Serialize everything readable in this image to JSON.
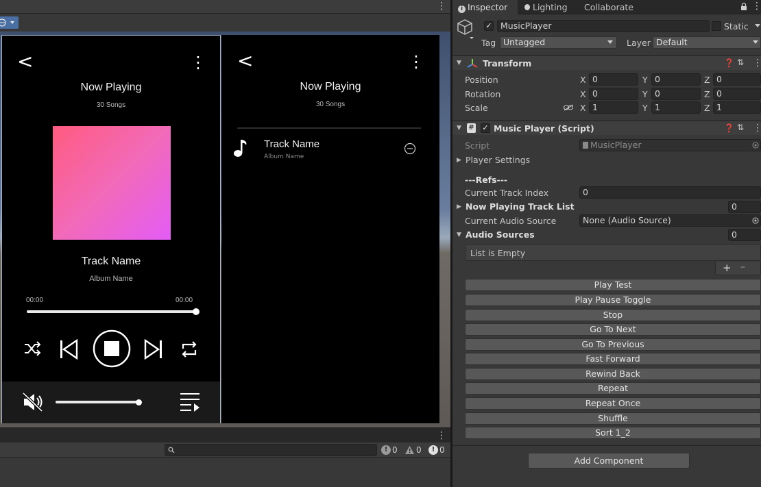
{
  "game_view": {
    "menu_glyph": "⋮",
    "phone_now_playing": {
      "back": "<",
      "menu": "⋮",
      "title": "Now Playing",
      "subtitle": "30 Songs",
      "track_name": "Track Name",
      "album_name": "Album Name",
      "time_current": "00:00",
      "time_total": "00:00",
      "progress": 1.0,
      "volume": 0.95
    },
    "phone_playlist": {
      "back": "<",
      "menu": "⋮",
      "title": "Now Playing",
      "subtitle": "30 Songs",
      "rows": [
        {
          "track": "Track Name",
          "album": "Album Name"
        }
      ]
    }
  },
  "console": {
    "menu_glyph": "⋮",
    "search_placeholder": "",
    "info_count": "0",
    "warning_count": "0",
    "error_count": "0"
  },
  "inspector": {
    "tabs": [
      {
        "label": "Inspector",
        "icon": "info-icon"
      },
      {
        "label": "Lighting",
        "icon": "bulb-icon"
      },
      {
        "label": "Collaborate",
        "icon": ""
      }
    ],
    "object": {
      "name": "MusicPlayer",
      "active": true,
      "static_label": "Static",
      "tag_label": "Tag",
      "tag_value": "Untagged",
      "layer_label": "Layer",
      "layer_value": "Default"
    },
    "transform": {
      "title": "Transform",
      "position": {
        "label": "Position",
        "x": "0",
        "y": "0",
        "z": "0"
      },
      "rotation": {
        "label": "Rotation",
        "x": "0",
        "y": "0",
        "z": "0"
      },
      "scale": {
        "label": "Scale",
        "x": "1",
        "y": "1",
        "z": "1"
      },
      "axis_x": "X",
      "axis_y": "Y",
      "axis_z": "Z"
    },
    "music_player": {
      "title": "Music Player (Script)",
      "script_label": "Script",
      "script_value": "MusicPlayer",
      "player_settings": "Player Settings",
      "refs_header": "---Refs---",
      "current_track_index_label": "Current Track Index",
      "current_track_index_value": "0",
      "now_playing_list_label": "Now Playing Track List",
      "now_playing_list_count": "0",
      "current_audio_source_label": "Current Audio Source",
      "current_audio_source_value": "None (Audio Source)",
      "audio_sources_label": "Audio Sources",
      "audio_sources_count": "0",
      "list_empty": "List is Empty",
      "add_glyph": "+",
      "remove_glyph": "–",
      "buttons": [
        "Play Test",
        "Play Pause Toggle",
        "Stop",
        "Go To Next",
        "Go To Previous",
        "Fast Forward",
        "Rewind Back",
        "Repeat",
        "Repeat Once",
        "Shuffle",
        "Sort 1_2"
      ]
    },
    "add_component": "Add Component"
  }
}
